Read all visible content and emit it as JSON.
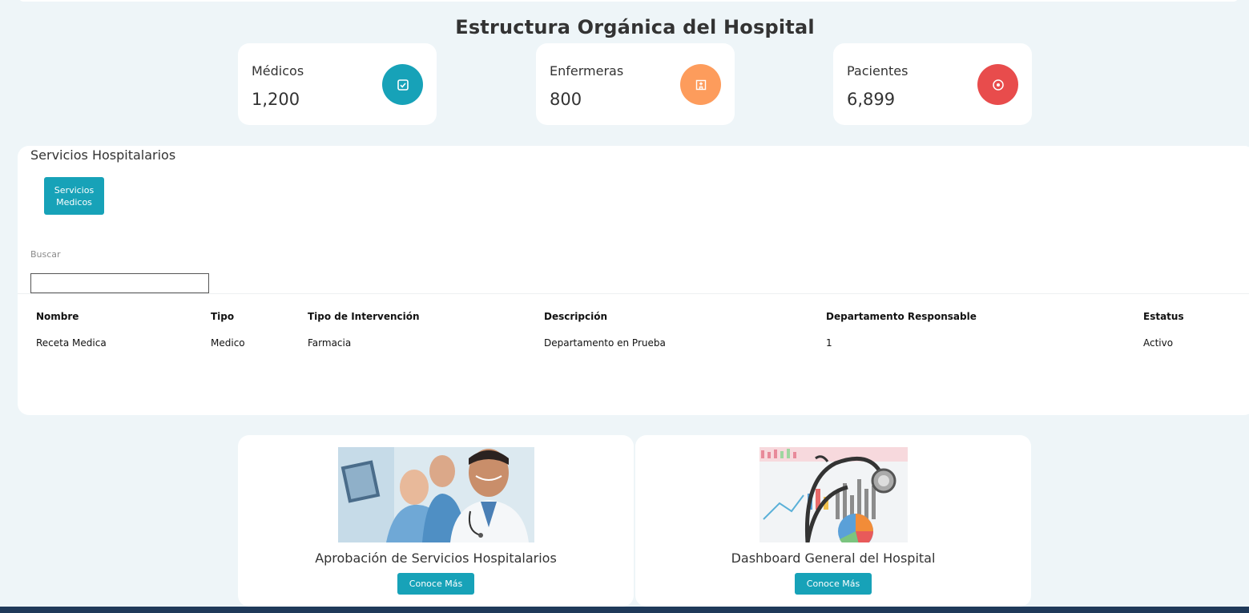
{
  "page_title": "Estructura Orgánica del Hospital",
  "stats": [
    {
      "label": "Médicos",
      "value": "1,200",
      "icon": "clipboard-check-icon",
      "color": "#17a2b8"
    },
    {
      "label": "Enfermeras",
      "value": "800",
      "icon": "hospital-building-icon",
      "color": "#fd9c5c"
    },
    {
      "label": "Pacientes",
      "value": "6,899",
      "icon": "target-icon",
      "color": "#e84c4c"
    }
  ],
  "services": {
    "title": "Servicios Hospitalarios",
    "tab_label": "Servicios Medicos",
    "search_label": "Buscar",
    "search_value": "",
    "columns": [
      "Nombre",
      "Tipo",
      "Tipo de Intervención",
      "Descripción",
      "Departamento Responsable",
      "Estatus"
    ],
    "rows": [
      [
        "Receta Medica",
        "Medico",
        "Farmacia",
        "Departamento en Prueba",
        "1",
        "Activo"
      ]
    ]
  },
  "cards": [
    {
      "title": "Aprobación de Servicios Hospitalarios",
      "button": "Conoce Más",
      "image": "doctors-photo"
    },
    {
      "title": "Dashboard General del Hospital",
      "button": "Conoce Más",
      "image": "stethoscope-charts-photo"
    }
  ],
  "accent_color": "#17a2b8"
}
